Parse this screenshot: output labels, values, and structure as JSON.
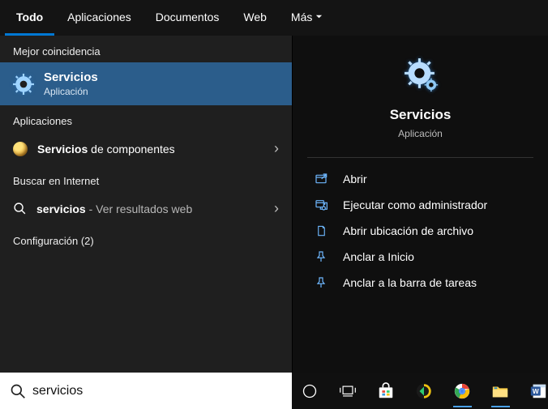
{
  "tabs": {
    "todo": "Todo",
    "apps": "Aplicaciones",
    "docs": "Documentos",
    "web": "Web",
    "more": "Más"
  },
  "left": {
    "bestLabel": "Mejor coincidencia",
    "best": {
      "title": "Servicios",
      "sub": "Aplicación"
    },
    "appsLabel": "Aplicaciones",
    "compServPrefix": "Servicios",
    "compServRest": " de componentes",
    "webLabel": "Buscar en Internet",
    "webQuery": "servicios",
    "webRest": " - Ver resultados web",
    "configLabel": "Configuración (2)"
  },
  "preview": {
    "name": "Servicios",
    "sub": "Aplicación",
    "actions": {
      "open": "Abrir",
      "admin": "Ejecutar como administrador",
      "loc": "Abrir ubicación de archivo",
      "pinStart": "Anclar a Inicio",
      "pinTaskbar": "Anclar a la barra de tareas"
    }
  },
  "search": {
    "value": "servicios"
  }
}
